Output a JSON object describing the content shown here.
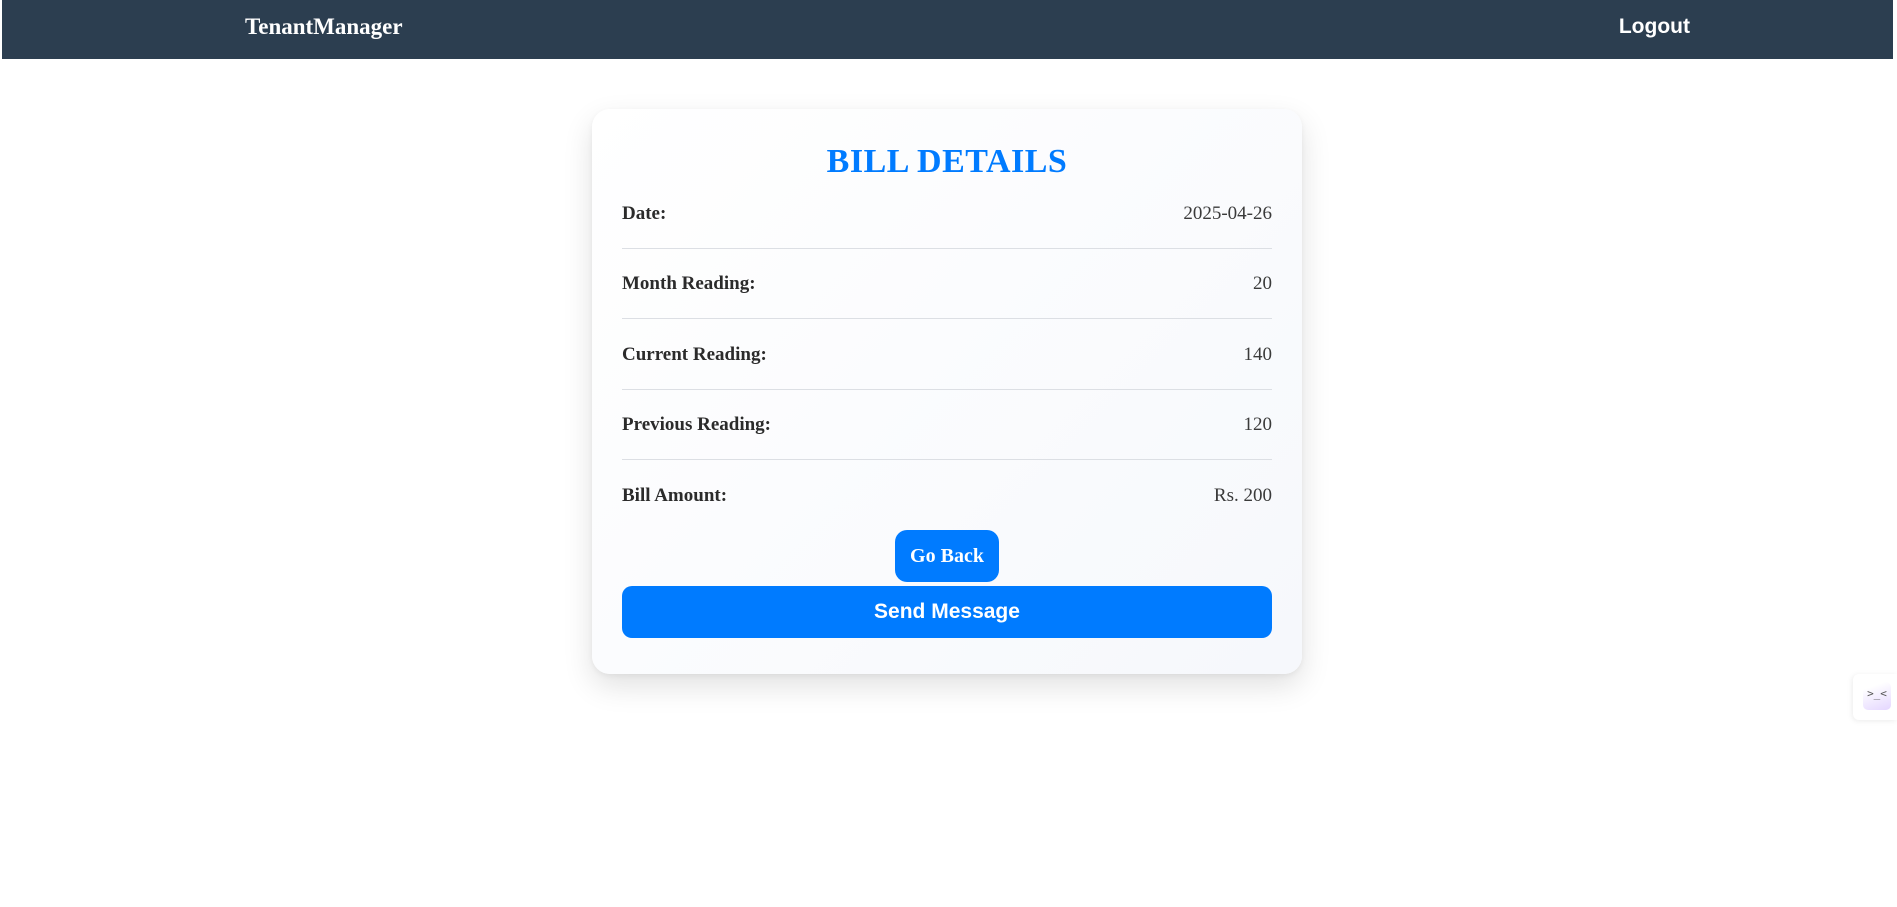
{
  "navbar": {
    "brand": "TenantManager",
    "logout_label": "Logout"
  },
  "bill": {
    "title": "BILL DETAILS",
    "rows": [
      {
        "label": "Date:",
        "value": "2025-04-26"
      },
      {
        "label": "Month Reading:",
        "value": "20"
      },
      {
        "label": "Current Reading:",
        "value": "140"
      },
      {
        "label": "Previous Reading:",
        "value": "120"
      },
      {
        "label": "Bill Amount:",
        "value": "Rs. 200"
      }
    ],
    "go_back_label": "Go Back",
    "send_message_label": "Send Message"
  },
  "widget": {
    "icon": "face-icon",
    "glyph": ">_<"
  },
  "colors": {
    "navbar": "#2c3e50",
    "accent": "#007bff"
  }
}
